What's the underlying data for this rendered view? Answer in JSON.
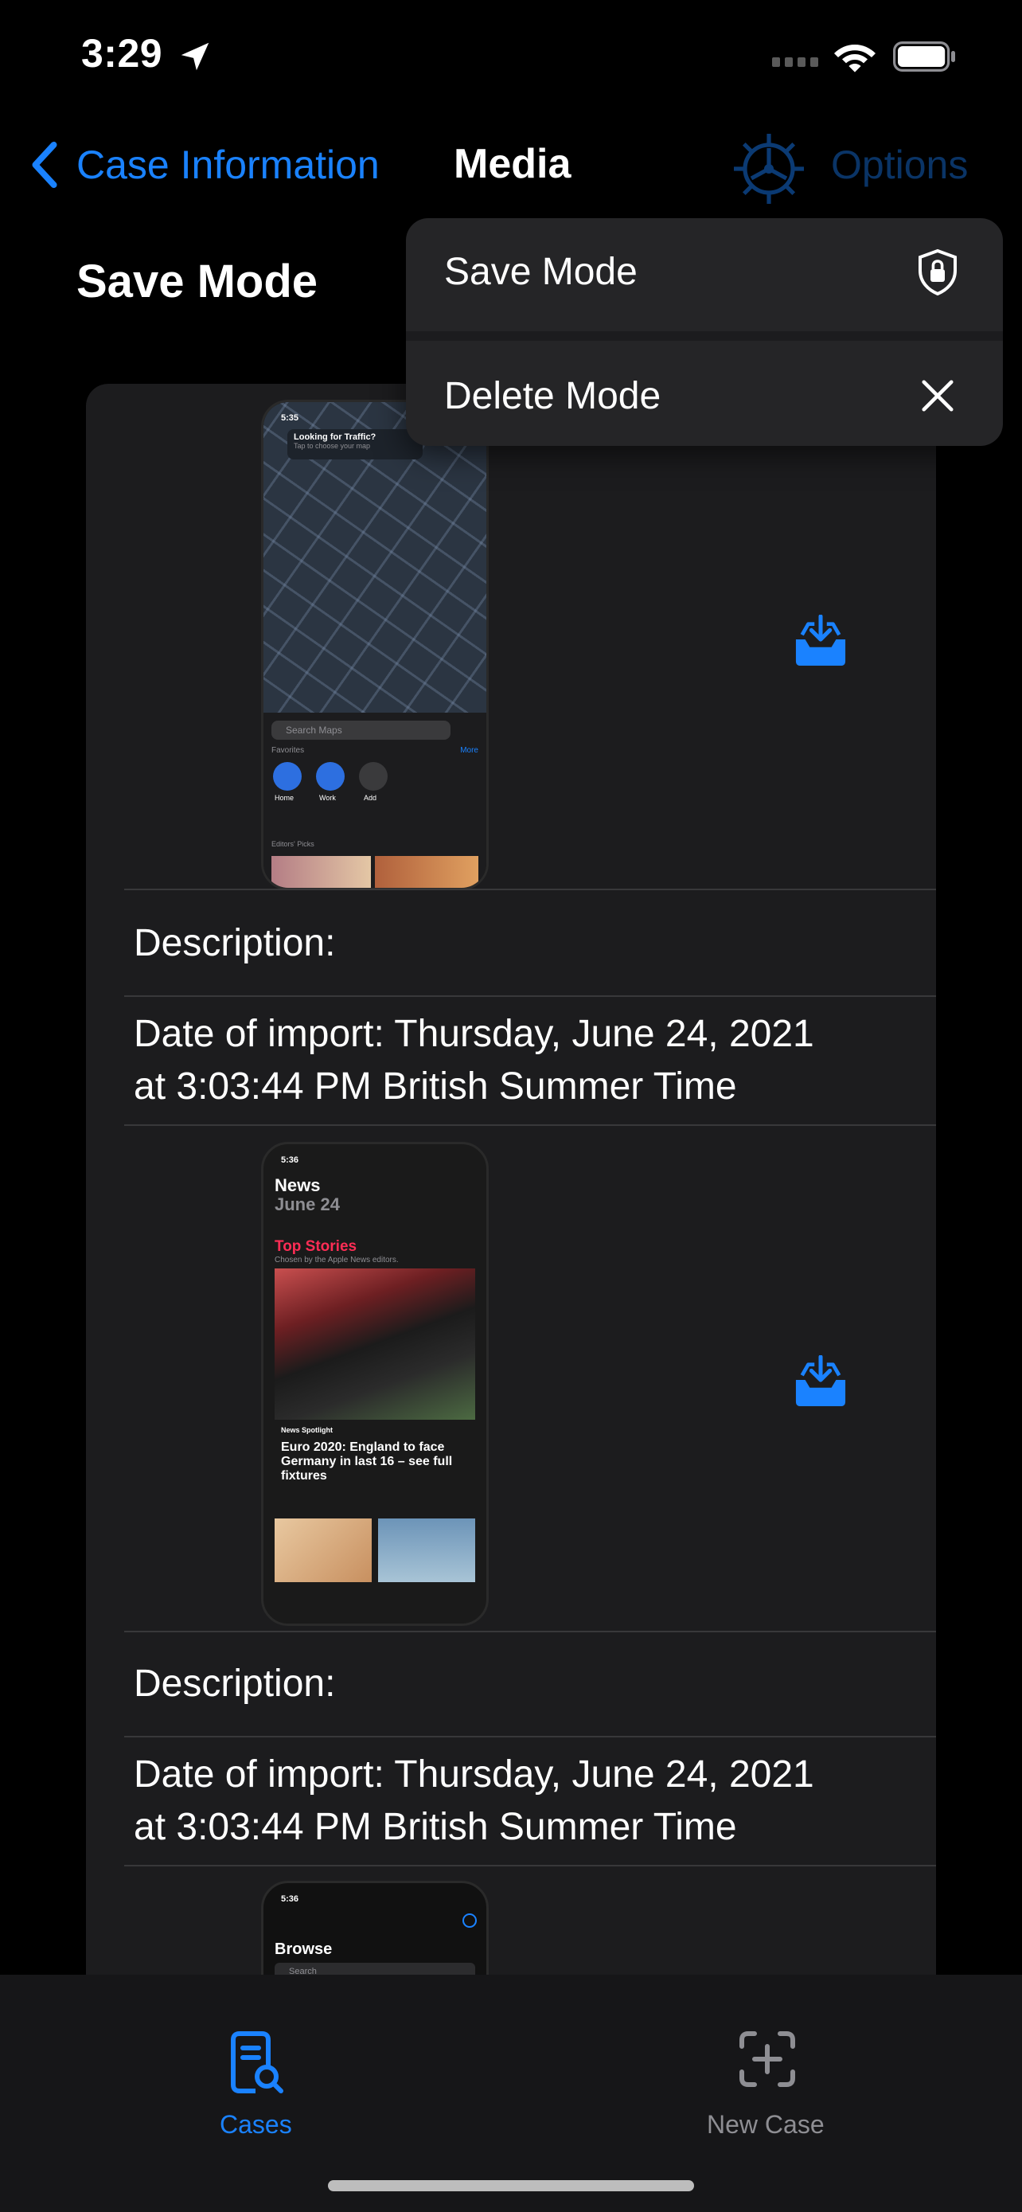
{
  "status_bar": {
    "time": "3:29"
  },
  "nav": {
    "back_label": "Case Information",
    "title": "Media",
    "options_label": "Options"
  },
  "mode_title": "Save Mode",
  "menu": {
    "items": [
      {
        "label": "Save Mode",
        "icon": "lock-shield-icon"
      },
      {
        "label": "Delete Mode",
        "icon": "close-icon"
      }
    ]
  },
  "media_items": [
    {
      "description": "Description:",
      "date_line1": "Date of import: Thursday, June 24, 2021",
      "date_line2": "at 3:03:44 PM British Summer Time",
      "thumb": {
        "time": "5:35",
        "banner": "Looking for Traffic?",
        "banner_sub": "Tap to choose your map",
        "search_placeholder": "Search Maps",
        "favorites": "Favorites",
        "more": "More",
        "fav1": "Home",
        "fav2": "Work",
        "fav3": "Add",
        "editors": "Editors' Picks"
      }
    },
    {
      "description": "Description:",
      "date_line1": "Date of import: Thursday, June 24, 2021",
      "date_line2": "at 3:03:44 PM British Summer Time",
      "thumb": {
        "time": "5:36",
        "app": "News",
        "date": "June 24",
        "section": "Top Stories",
        "section_sub": "Chosen by the Apple News editors.",
        "spotlight": "News Spotlight",
        "headline": "Euro 2020: England to face Germany in last 16 – see full fixtures"
      }
    },
    {
      "thumb": {
        "time": "5:36",
        "title": "Browse",
        "search_placeholder": "Search"
      }
    }
  ],
  "tabs": [
    {
      "label": "Cases",
      "icon": "case-search-icon",
      "active": true
    },
    {
      "label": "New Case",
      "icon": "add-case-icon",
      "active": false
    }
  ],
  "colors": {
    "accent": "#1a82ff",
    "background": "#000000",
    "card": "#1c1c1e"
  }
}
